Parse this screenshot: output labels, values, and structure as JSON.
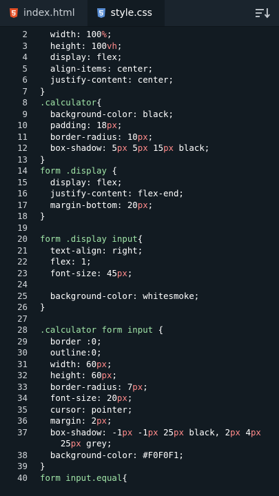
{
  "tabs": [
    {
      "label": "index.html",
      "icon": "html5-icon",
      "active": false
    },
    {
      "label": "style.css",
      "icon": "css3-icon",
      "active": true
    }
  ],
  "colors": {
    "background": "#121b22",
    "tabbar": "#1a242d",
    "selector": "#9fe3a6",
    "unit": "#ff8a8a",
    "html_icon": "#e34f26",
    "css_icon": "#5a8fd6"
  },
  "code_lines": [
    {
      "n": "2",
      "indent": 1,
      "parts": [
        [
          "p",
          "width: "
        ],
        [
          "v",
          "100"
        ],
        [
          "u",
          "%"
        ],
        [
          "p",
          ";"
        ]
      ]
    },
    {
      "n": "3",
      "indent": 1,
      "parts": [
        [
          "p",
          "height: "
        ],
        [
          "v",
          "100"
        ],
        [
          "u",
          "vh"
        ],
        [
          "p",
          ";"
        ]
      ]
    },
    {
      "n": "4",
      "indent": 1,
      "parts": [
        [
          "p",
          "display: flex;"
        ]
      ]
    },
    {
      "n": "5",
      "indent": 1,
      "parts": [
        [
          "p",
          "align-items: center;"
        ]
      ]
    },
    {
      "n": "6",
      "indent": 1,
      "parts": [
        [
          "p",
          "justify-content: center;"
        ]
      ]
    },
    {
      "n": "7",
      "indent": 0,
      "parts": [
        [
          "p",
          "}"
        ]
      ]
    },
    {
      "n": "8",
      "indent": 0,
      "parts": [
        [
          "s",
          ".calculator"
        ],
        [
          "p",
          "{"
        ]
      ]
    },
    {
      "n": "9",
      "indent": 1,
      "parts": [
        [
          "p",
          "background-color: black;"
        ]
      ]
    },
    {
      "n": "10",
      "indent": 1,
      "parts": [
        [
          "p",
          "padding: "
        ],
        [
          "v",
          "18"
        ],
        [
          "u",
          "px"
        ],
        [
          "p",
          ";"
        ]
      ]
    },
    {
      "n": "11",
      "indent": 1,
      "parts": [
        [
          "p",
          "border-radius: "
        ],
        [
          "v",
          "10"
        ],
        [
          "u",
          "px"
        ],
        [
          "p",
          ";"
        ]
      ]
    },
    {
      "n": "12",
      "indent": 1,
      "parts": [
        [
          "p",
          "box-shadow: "
        ],
        [
          "v",
          "5"
        ],
        [
          "u",
          "px"
        ],
        [
          "p",
          " "
        ],
        [
          "v",
          "5"
        ],
        [
          "u",
          "px"
        ],
        [
          "p",
          " "
        ],
        [
          "v",
          "15"
        ],
        [
          "u",
          "px"
        ],
        [
          "p",
          " black;"
        ]
      ]
    },
    {
      "n": "13",
      "indent": 0,
      "parts": [
        [
          "p",
          "}"
        ]
      ]
    },
    {
      "n": "14",
      "indent": 0,
      "parts": [
        [
          "s",
          "form .display"
        ],
        [
          "p",
          " {"
        ]
      ]
    },
    {
      "n": "15",
      "indent": 1,
      "parts": [
        [
          "p",
          "display: flex;"
        ]
      ]
    },
    {
      "n": "16",
      "indent": 1,
      "parts": [
        [
          "p",
          "justify-content: flex-end;"
        ]
      ]
    },
    {
      "n": "17",
      "indent": 1,
      "parts": [
        [
          "p",
          "margin-bottom: "
        ],
        [
          "v",
          "20"
        ],
        [
          "u",
          "px"
        ],
        [
          "p",
          ";"
        ]
      ]
    },
    {
      "n": "18",
      "indent": 0,
      "parts": [
        [
          "p",
          "}"
        ]
      ]
    },
    {
      "n": "19",
      "indent": 0,
      "parts": []
    },
    {
      "n": "20",
      "indent": 0,
      "parts": [
        [
          "s",
          "form .display input"
        ],
        [
          "p",
          "{"
        ]
      ]
    },
    {
      "n": "21",
      "indent": 1,
      "parts": [
        [
          "p",
          "text-align: right;"
        ]
      ]
    },
    {
      "n": "22",
      "indent": 1,
      "parts": [
        [
          "p",
          "flex: "
        ],
        [
          "v",
          "1"
        ],
        [
          "p",
          ";"
        ]
      ]
    },
    {
      "n": "23",
      "indent": 1,
      "parts": [
        [
          "p",
          "font-size: "
        ],
        [
          "v",
          "45"
        ],
        [
          "u",
          "px"
        ],
        [
          "p",
          ";"
        ]
      ]
    },
    {
      "n": "24",
      "indent": 0,
      "parts": []
    },
    {
      "n": "25",
      "indent": 1,
      "parts": [
        [
          "p",
          "background-color: whitesmoke;"
        ]
      ]
    },
    {
      "n": "26",
      "indent": 0,
      "parts": [
        [
          "p",
          "}"
        ]
      ]
    },
    {
      "n": "27",
      "indent": 0,
      "parts": []
    },
    {
      "n": "28",
      "indent": 0,
      "parts": [
        [
          "s",
          ".calculator form input"
        ],
        [
          "p",
          " {"
        ]
      ]
    },
    {
      "n": "29",
      "indent": 1,
      "parts": [
        [
          "p",
          "border :"
        ],
        [
          "v",
          "0"
        ],
        [
          "p",
          ";"
        ]
      ]
    },
    {
      "n": "30",
      "indent": 1,
      "parts": [
        [
          "p",
          "outline:"
        ],
        [
          "v",
          "0"
        ],
        [
          "p",
          ";"
        ]
      ]
    },
    {
      "n": "31",
      "indent": 1,
      "parts": [
        [
          "p",
          "width: "
        ],
        [
          "v",
          "60"
        ],
        [
          "u",
          "px"
        ],
        [
          "p",
          ";"
        ]
      ]
    },
    {
      "n": "32",
      "indent": 1,
      "parts": [
        [
          "p",
          "height: "
        ],
        [
          "v",
          "60"
        ],
        [
          "u",
          "px"
        ],
        [
          "p",
          ";"
        ]
      ]
    },
    {
      "n": "33",
      "indent": 1,
      "parts": [
        [
          "p",
          "border-radius: "
        ],
        [
          "v",
          "7"
        ],
        [
          "u",
          "px"
        ],
        [
          "p",
          ";"
        ]
      ]
    },
    {
      "n": "34",
      "indent": 1,
      "parts": [
        [
          "p",
          "font-size: "
        ],
        [
          "v",
          "20"
        ],
        [
          "u",
          "px"
        ],
        [
          "p",
          ";"
        ]
      ]
    },
    {
      "n": "35",
      "indent": 1,
      "parts": [
        [
          "p",
          "cursor: pointer;"
        ]
      ]
    },
    {
      "n": "36",
      "indent": 1,
      "parts": [
        [
          "p",
          "margin: "
        ],
        [
          "v",
          "2"
        ],
        [
          "u",
          "px"
        ],
        [
          "p",
          ";"
        ]
      ]
    },
    {
      "n": "37",
      "indent": 1,
      "parts": [
        [
          "p",
          "box-shadow: -"
        ],
        [
          "v",
          "1"
        ],
        [
          "u",
          "px"
        ],
        [
          "p",
          " -"
        ],
        [
          "v",
          "1"
        ],
        [
          "u",
          "px"
        ],
        [
          "p",
          " "
        ],
        [
          "v",
          "25"
        ],
        [
          "u",
          "px"
        ],
        [
          "p",
          " black, "
        ],
        [
          "v",
          "2"
        ],
        [
          "u",
          "px"
        ],
        [
          "p",
          " "
        ],
        [
          "v",
          "4"
        ],
        [
          "u",
          "px"
        ]
      ]
    },
    {
      "n": "",
      "indent": 2,
      "parts": [
        [
          "v",
          "25"
        ],
        [
          "u",
          "px"
        ],
        [
          "p",
          " grey;"
        ]
      ]
    },
    {
      "n": "38",
      "indent": 1,
      "parts": [
        [
          "p",
          "background-color: #F0F0F1;"
        ]
      ]
    },
    {
      "n": "39",
      "indent": 0,
      "parts": [
        [
          "p",
          "}"
        ]
      ]
    },
    {
      "n": "40",
      "indent": 0,
      "parts": [
        [
          "s",
          "form input.equal"
        ],
        [
          "p",
          "{"
        ]
      ]
    }
  ]
}
